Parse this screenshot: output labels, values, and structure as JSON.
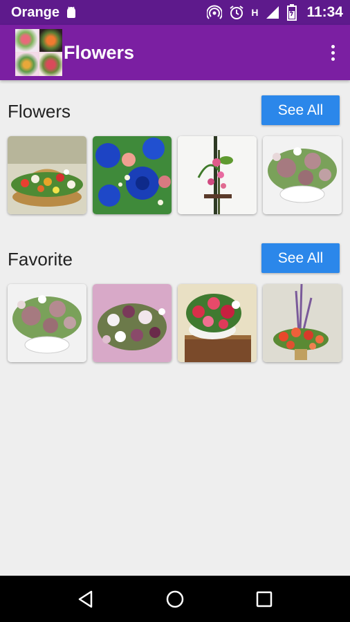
{
  "status": {
    "carrier": "Orange",
    "network": "H",
    "time": "11:34"
  },
  "app": {
    "title": "Flowers"
  },
  "sections": [
    {
      "title": "Flowers",
      "button": "See All"
    },
    {
      "title": "Favorite",
      "button": "See All"
    }
  ],
  "colors": {
    "status_bar": "#5e1a8c",
    "app_bar": "#7b1fa2",
    "button": "#2b87ea",
    "background": "#eeeeee"
  }
}
